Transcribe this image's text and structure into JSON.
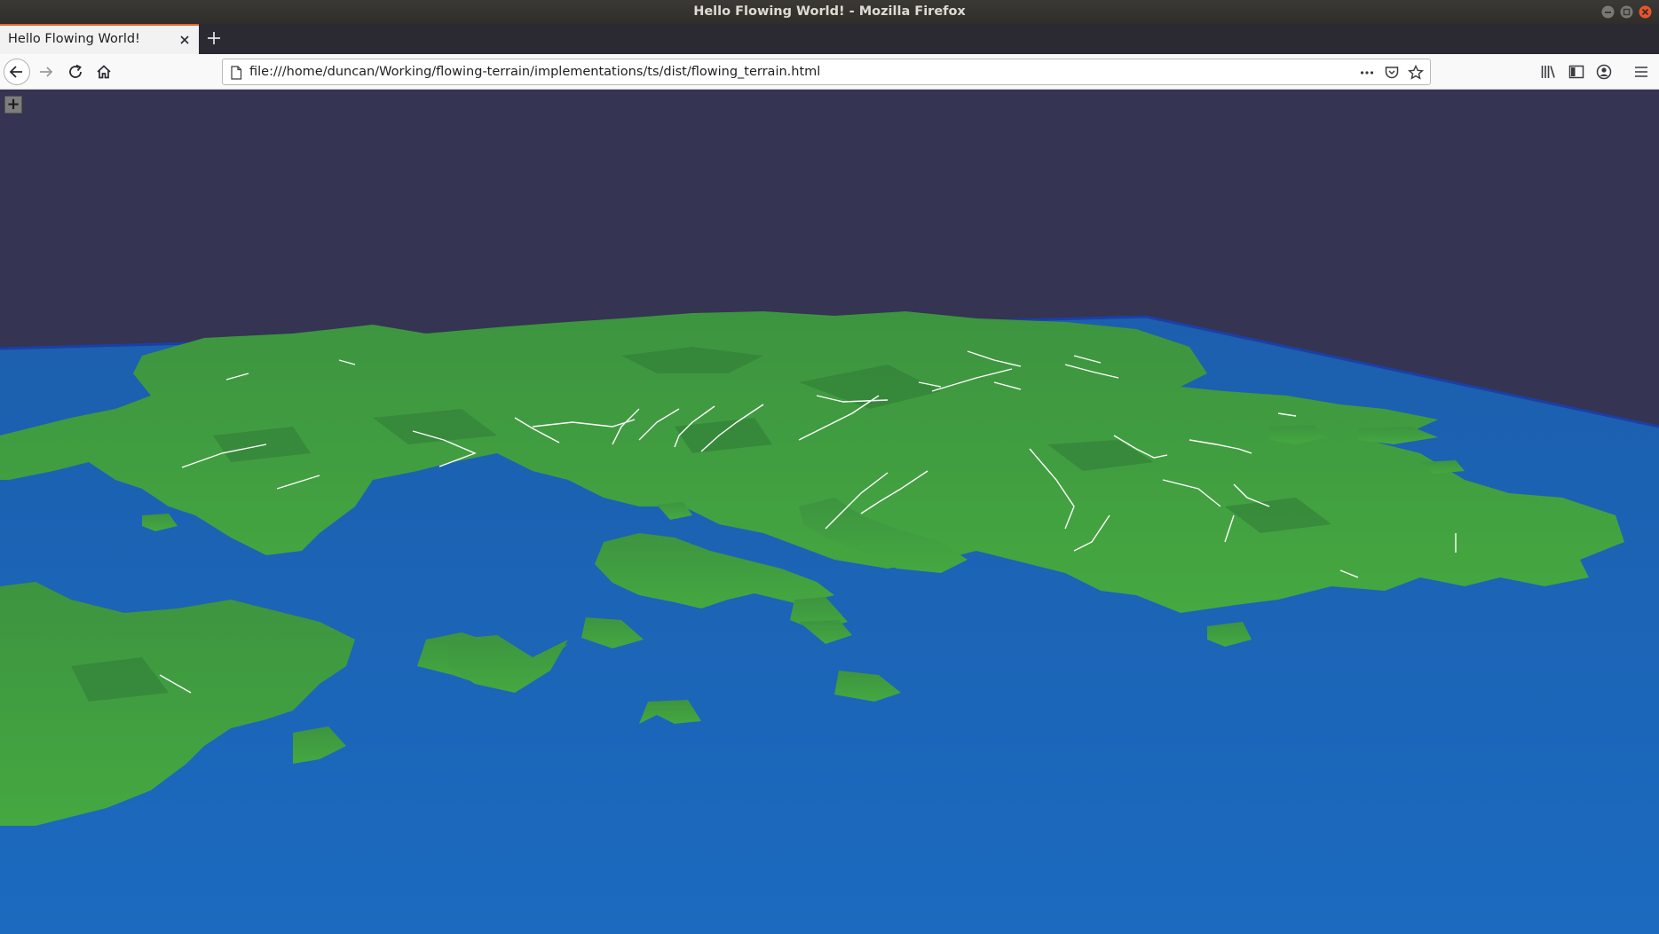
{
  "window": {
    "title": "Hello Flowing World! - Mozilla Firefox",
    "controls": [
      "minimize-icon",
      "maximize-icon",
      "close-icon"
    ]
  },
  "tabs": [
    {
      "label": "Hello Flowing World!",
      "active": true
    }
  ],
  "navbar": {
    "url": "file:///home/duncan/Working/flowing-terrain/implementations/ts/dist/flowing_terrain.html",
    "icons": [
      "back-icon",
      "forward-icon",
      "reload-icon",
      "home-icon",
      "page-icon",
      "more-icon",
      "pocket-icon",
      "bookmark-star-icon",
      "library-icon",
      "sidebar-icon",
      "account-icon",
      "menu-icon"
    ]
  },
  "page": {
    "gui_toggle_label": "+",
    "colors": {
      "sky": "#353452",
      "sea": "#1b63b3",
      "sea_edge": "#1b40a8",
      "land": "#3f9a3e",
      "river": "#ffffff"
    }
  }
}
